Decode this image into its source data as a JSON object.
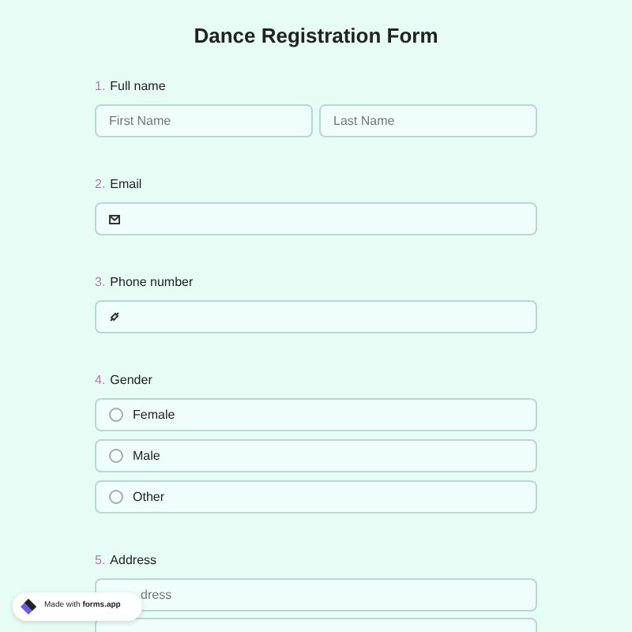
{
  "title": "Dance Registration Form",
  "questions": [
    {
      "number": "1.",
      "label": "Full name",
      "kind": "name",
      "fields": [
        {
          "placeholder": "First Name"
        },
        {
          "placeholder": "Last Name"
        }
      ]
    },
    {
      "number": "2.",
      "label": "Email",
      "kind": "email"
    },
    {
      "number": "3.",
      "label": "Phone number",
      "kind": "phone"
    },
    {
      "number": "4.",
      "label": "Gender",
      "kind": "choice",
      "options": [
        {
          "label": "Female",
          "selected": false
        },
        {
          "label": "Male",
          "selected": false
        },
        {
          "label": "Other",
          "selected": false
        }
      ]
    },
    {
      "number": "5.",
      "label": "Address",
      "kind": "address",
      "fields": [
        {
          "placeholder": "dress"
        }
      ]
    }
  ],
  "badge": {
    "text": "Made with ",
    "brand": "forms.app"
  }
}
